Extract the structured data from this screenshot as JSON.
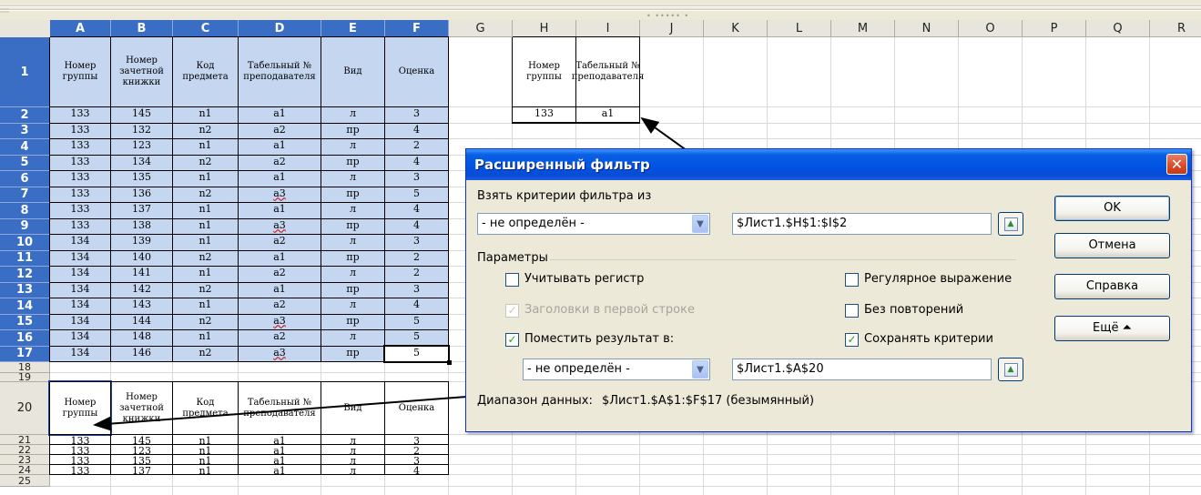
{
  "toolbar": {
    "dots": "• ••••• •"
  },
  "columns": [
    "A",
    "B",
    "C",
    "D",
    "E",
    "F",
    "G",
    "H",
    "I",
    "J",
    "K",
    "L",
    "M",
    "N",
    "O",
    "P",
    "Q",
    "R"
  ],
  "rows": [
    "1",
    "2",
    "3",
    "4",
    "5",
    "6",
    "7",
    "8",
    "9",
    "10",
    "11",
    "12",
    "13",
    "14",
    "15",
    "16",
    "17",
    "18",
    "19",
    "20",
    "21",
    "22",
    "23",
    "24",
    "25"
  ],
  "main_table": {
    "headers": [
      "Номер группы",
      "Номер зачетной книжки",
      "Код предмета",
      "Табельный № преподавателя",
      "Вид",
      "Оценка"
    ],
    "rows": [
      [
        "133",
        "145",
        "n1",
        "a1",
        "л",
        "3"
      ],
      [
        "133",
        "132",
        "n2",
        "a2",
        "пр",
        "4"
      ],
      [
        "133",
        "123",
        "n1",
        "a1",
        "л",
        "2"
      ],
      [
        "133",
        "134",
        "n2",
        "a2",
        "пр",
        "4"
      ],
      [
        "133",
        "135",
        "n1",
        "a1",
        "л",
        "3"
      ],
      [
        "133",
        "136",
        "n2",
        "a3",
        "пр",
        "5"
      ],
      [
        "133",
        "137",
        "n1",
        "a1",
        "л",
        "4"
      ],
      [
        "133",
        "138",
        "n1",
        "a3",
        "пр",
        "4"
      ],
      [
        "134",
        "139",
        "n1",
        "a2",
        "л",
        "3"
      ],
      [
        "134",
        "140",
        "n2",
        "a1",
        "пр",
        "2"
      ],
      [
        "134",
        "141",
        "n1",
        "a2",
        "л",
        "2"
      ],
      [
        "134",
        "142",
        "n2",
        "a1",
        "пр",
        "3"
      ],
      [
        "134",
        "143",
        "n1",
        "a2",
        "л",
        "4"
      ],
      [
        "134",
        "144",
        "n2",
        "a3",
        "пр",
        "5"
      ],
      [
        "134",
        "148",
        "n1",
        "a2",
        "л",
        "5"
      ],
      [
        "134",
        "146",
        "n2",
        "a3",
        "пр",
        "5"
      ]
    ]
  },
  "criteria_table": {
    "headers": [
      "Номер группы",
      "Табельный № преподавателя"
    ],
    "row": [
      "133",
      "a1"
    ]
  },
  "result_table": {
    "headers": [
      "Номер группы",
      "Номер зачетной книжки",
      "Код предмета",
      "Табельный № преподавателя",
      "Вид",
      "Оценка"
    ],
    "rows": [
      [
        "133",
        "145",
        "n1",
        "a1",
        "л",
        "3"
      ],
      [
        "133",
        "123",
        "n1",
        "a1",
        "л",
        "2"
      ],
      [
        "133",
        "135",
        "n1",
        "a1",
        "л",
        "3"
      ],
      [
        "133",
        "137",
        "n1",
        "a1",
        "л",
        "4"
      ]
    ]
  },
  "dialog": {
    "title": "Расширенный фильтр",
    "close_glyph": "✕",
    "criteria_label": "Взять критерии фильтра из",
    "criteria_combo": "- не определён -",
    "criteria_range": "$Лист1.$H$1:$I$2",
    "params_label": "Параметры",
    "opt_case": "Учитывать регистр",
    "opt_regex": "Регулярное выражение",
    "opt_headers": "Заголовки в первой строке",
    "opt_unique": "Без повторений",
    "opt_copy": "Поместить результат в:",
    "opt_keep": "Сохранять критерии",
    "output_combo": "- не определён -",
    "output_range": "$Лист1.$A$20",
    "data_range_label": "Диапазон данных:",
    "data_range_value": "$Лист1.$A$1:$F$17 (безымянный)",
    "btn_ok": "OK",
    "btn_cancel": "Отмена",
    "btn_help": "Справка",
    "btn_more": "Ещё ⏶",
    "check_glyph": "✓",
    "combo_arrow": "▼",
    "ref_icon": "▲",
    "checkboxes": {
      "case": false,
      "regex": false,
      "headers": true,
      "unique": false,
      "copy": true,
      "keep": true
    }
  },
  "colors": {
    "selection_header": "#3a6ec5",
    "selection_fill": "#c5d6f1",
    "dialog_title": "#0054e3",
    "close": "#d94a27"
  }
}
